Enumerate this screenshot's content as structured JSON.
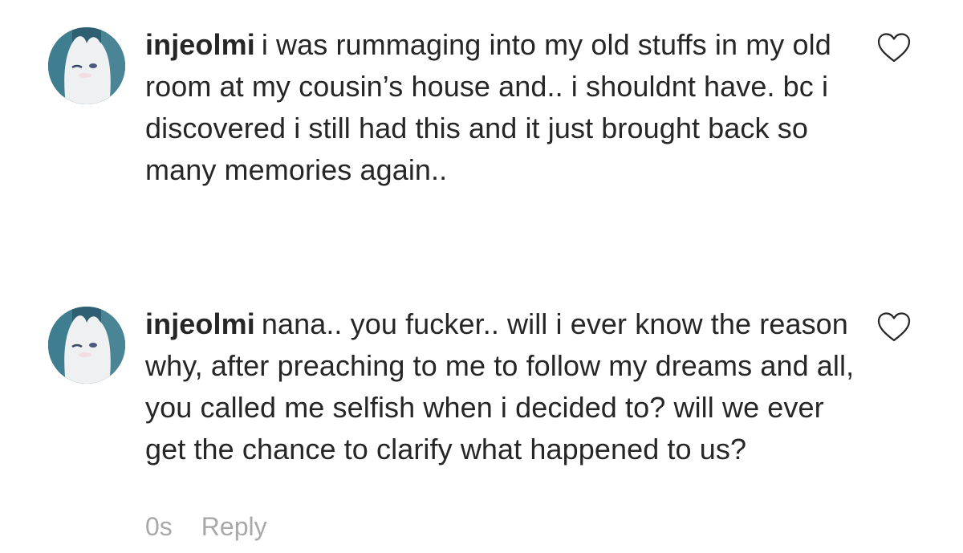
{
  "comments": [
    {
      "username": "injeolmi",
      "text": "i was rummaging into my old stuffs in my old room at my cousin’s house and.. i shouldnt have. bc i discovered i still had this and it just brought back so many memories again.."
    },
    {
      "username": "injeolmi",
      "text": "nana.. you fucker.. will i ever know the reason why, after preaching to me to follow my dreams and all, you called me selfish when i decided to? will we ever get the chance to clarify what happened to us?",
      "timestamp": "0s",
      "reply_label": "Reply"
    }
  ],
  "icons": {
    "avatar": "moomin-avatar",
    "like": "heart-outline-icon"
  },
  "colors": {
    "text": "#262626",
    "meta": "#a8a8a8",
    "avatar_bg": "#3b6e80"
  }
}
